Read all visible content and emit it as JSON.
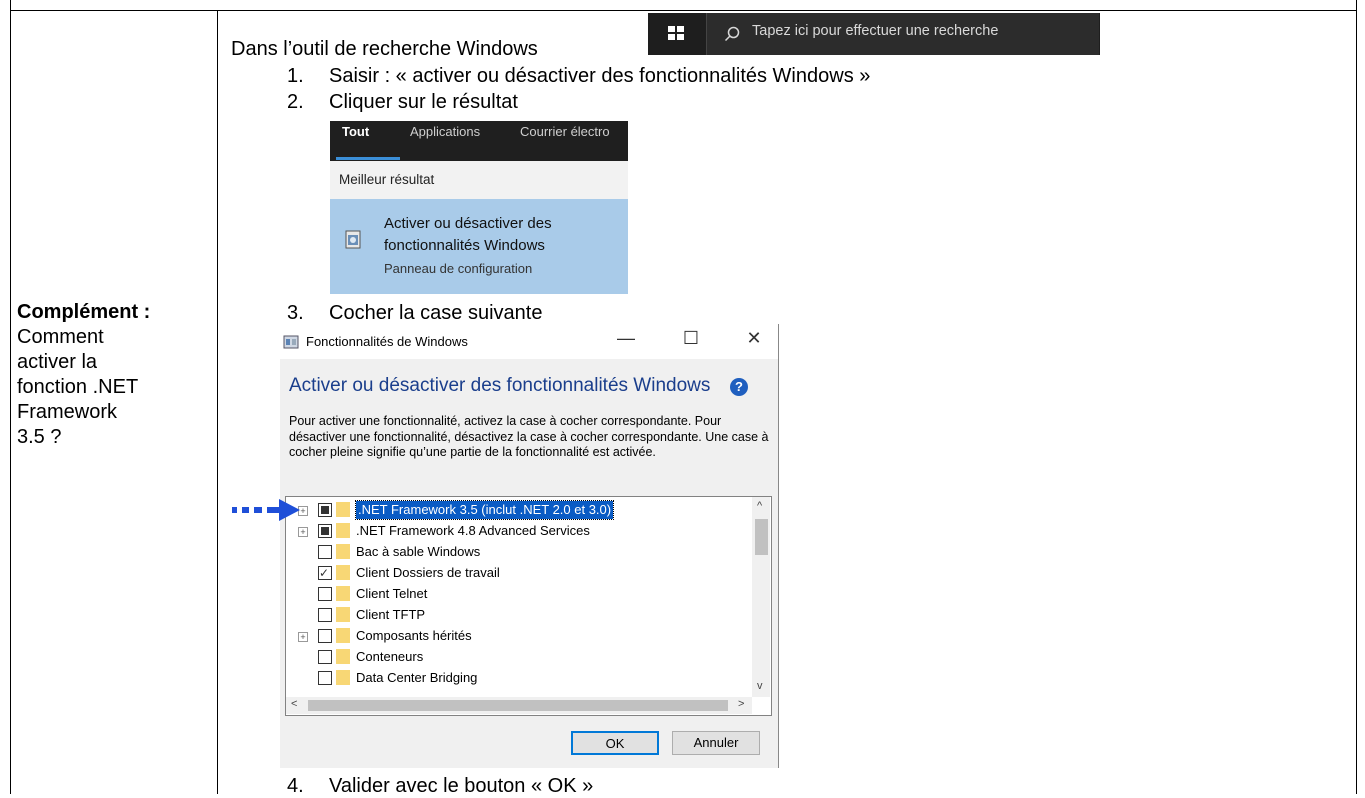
{
  "left_cell": {
    "heading": "Complément :",
    "lines": [
      "Comment",
      "activer la",
      "fonction .NET",
      "Framework",
      "3.5 ?"
    ]
  },
  "intro": "Dans l’outil de recherche Windows",
  "taskbar": {
    "windows_icon": "windows-logo-icon",
    "search_icon": "search-icon",
    "search_placeholder": "Tapez ici pour effectuer une recherche"
  },
  "steps": [
    {
      "num": "1.",
      "text": "Saisir : « activer ou désactiver des fonctionnalités Windows »"
    },
    {
      "num": "2.",
      "text": "Cliquer sur le résultat"
    },
    {
      "num": "3.",
      "text": "Cocher la case suivante"
    },
    {
      "num": "4.",
      "text": "Valider avec le bouton « OK »"
    }
  ],
  "search_result": {
    "tabs": [
      "Tout",
      "Applications",
      "Courrier électro"
    ],
    "best_label": "Meilleur résultat",
    "title_line1": "Activer ou désactiver des",
    "title_line2": "fonctionnalités Windows",
    "subtitle": "Panneau de configuration"
  },
  "dialog": {
    "title": "Fonctionnalités de Windows",
    "minimize": "—",
    "maximize": "☐",
    "close": "✕",
    "heading": "Activer ou désactiver des fonctionnalités Windows",
    "help": "?",
    "description": "Pour activer une fonctionnalité, activez la case à cocher correspondante. Pour désactiver une fonctionnalité, désactivez la case à cocher correspondante. Une case à cocher pleine signifie qu’une partie de la fonctionnalité est activée.",
    "features": [
      {
        "label": ".NET Framework 3.5 (inclut .NET 2.0 et 3.0)",
        "state": "partial",
        "expandable": true,
        "selected": true
      },
      {
        "label": ".NET Framework 4.8 Advanced Services",
        "state": "partial",
        "expandable": true,
        "selected": false
      },
      {
        "label": "Bac à sable Windows",
        "state": "unchecked",
        "expandable": false,
        "selected": false
      },
      {
        "label": "Client Dossiers de travail",
        "state": "checked",
        "expandable": false,
        "selected": false
      },
      {
        "label": "Client Telnet",
        "state": "unchecked",
        "expandable": false,
        "selected": false
      },
      {
        "label": "Client TFTP",
        "state": "unchecked",
        "expandable": false,
        "selected": false
      },
      {
        "label": "Composants hérités",
        "state": "unchecked",
        "expandable": true,
        "selected": false
      },
      {
        "label": "Conteneurs",
        "state": "unchecked",
        "expandable": false,
        "selected": false
      },
      {
        "label": "Data Center Bridging",
        "state": "unchecked",
        "expandable": false,
        "selected": false
      }
    ],
    "ok_label": "OK",
    "cancel_label": "Annuler",
    "scroll_up": "^",
    "scroll_down": "v",
    "scroll_left": "<",
    "scroll_right": ">"
  },
  "colors": {
    "selection": "#0a5bc4",
    "heading_blue": "#1a3e8c",
    "result_highlight": "#a9cbe9",
    "arrow_blue": "#1f4fd8"
  }
}
